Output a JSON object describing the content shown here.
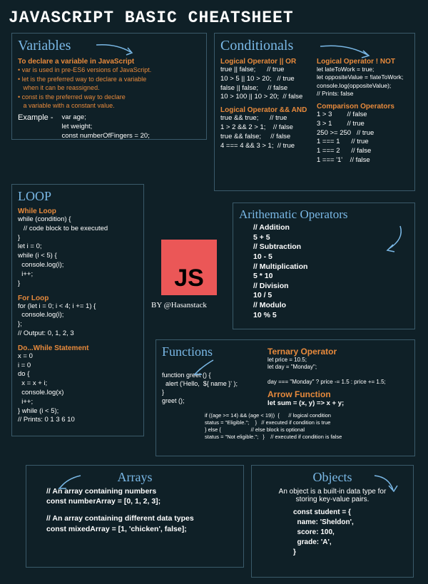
{
  "title": "JAVASCRIPT BASIC CHEATSHEET",
  "variables": {
    "heading": "Variables",
    "intro": "To declare a variable in JavaScript",
    "bullets": [
      "var is used in pre-ES6 versions of JavaScript.",
      "let is the preferred way to declare a variable\n   when it can be reassigned.",
      "const is the preferred way to declare\n   a variable with a constant value."
    ],
    "exampleLabel": "Example -",
    "example": "var age;\nlet weight;\nconst numberOfFingers = 20;"
  },
  "conditionals": {
    "heading": "Conditionals",
    "orHead": "Logical Operator || OR",
    "or": "true || false;      // true\n10 > 5 || 10 > 20;   // true\nfalse || false;     // false\n10 > 100 || 10 > 20;  // false",
    "andHead": "Logical Operator && AND",
    "and": "true && true;      // true\n1 > 2 && 2 > 1;    // false\ntrue && false;     // false\n4 === 4 && 3 > 1;  // true",
    "notHead": "Logical Operator ! NOT",
    "not": "let lateToWork = true;\nlet oppositeValue = !lateToWork;\nconsole.log(oppositeValue);\n// Prints: false",
    "compHead": "Comparison Operators",
    "comp": "1 > 3        // false\n3 > 1        // true\n250 >= 250   // true\n1 === 1      // true\n1 === 2      // false\n1 === '1'    // false"
  },
  "loop": {
    "heading": "LOOP",
    "whileHead": "While Loop",
    "while": "while (condition) {\n   // code block to be executed\n}\nlet i = 0;\nwhile (i < 5) {\n  console.log(i);\n  i++;\n}",
    "forHead": "For Loop",
    "for": "for (let i = 0; i < 4; i += 1) {\n  console.log(i);\n};\n// Output: 0, 1, 2, 3",
    "doHead": "Do...While Statement",
    "do": "x = 0\ni = 0\ndo {\n  x = x + i;\n  console.log(x)\n  i++;\n} while (i < 5);\n// Prints: 0 1 3 6 10"
  },
  "js": {
    "badge": "JS",
    "byline": "BY @Hasanstack"
  },
  "arith": {
    "heading": "Arithematic Operators",
    "body": "// Addition\n5 + 5\n// Subtraction\n10 - 5\n// Multiplication\n5 * 10\n// Division\n10 / 5\n// Modulo\n10 % 5"
  },
  "functions": {
    "heading": "Functions",
    "body": "function greet () {\n  alert ('Hello,  ${ name }' );\n}\ngreet ();",
    "ternHead": "Ternary Operator",
    "tern": "let price = 10.5;\nlet day = \"Monday\";\n\nday === \"Monday\" ? price -= 1.5 : price += 1.5;",
    "arrowHead": "Arrow Function",
    "arrow": "let sum = (x, y) => x + y;",
    "ifelse": "if ((age >= 14) && (age < 19))  {      // logical condition\nstatus = \"Eligible.\";    }   // executed if condition is true\n} else {                    // else block is optional\nstatus = \"Not eligible.\";   }    // executed if condition is false"
  },
  "arrays": {
    "heading": "Arrays",
    "l1": "// An array containing numbers",
    "l2": "const numberArray = [0, 1, 2, 3];",
    "l3": "// An array containing different data types",
    "l4": "const mixedArray = [1, 'chicken', false];"
  },
  "objects": {
    "heading": "Objects",
    "desc": "An object is a built-in data type for\nstoring key-value pairs.",
    "body": "const student = {\n  name: 'Sheldon',\n  score: 100,\n  grade: 'A',\n}"
  }
}
